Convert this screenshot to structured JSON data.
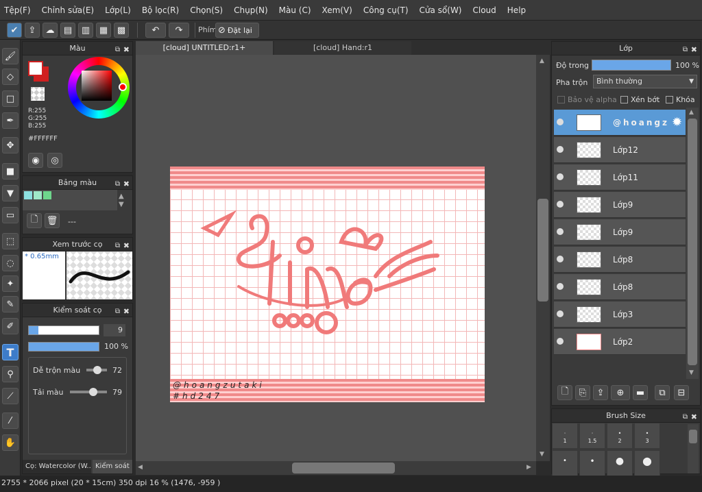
{
  "menu": [
    "Tệp(F)",
    "Chỉnh sửa(E)",
    "Lớp(L)",
    "Bộ lọc(R)",
    "Chọn(S)",
    "Chụp(N)",
    "Màu (C)",
    "Xem(V)",
    "Công cụ(T)",
    "Cửa sổ(W)",
    "Cloud",
    "Help"
  ],
  "toolbar": {
    "shortcut_label": "Phím",
    "reset_label": "Đặt lại"
  },
  "tools": [
    "brush-icon",
    "eraser-icon",
    "rectangle-select-tool-icon",
    "pen-icon",
    "move-icon",
    "fill-rect-icon",
    "bucket-icon",
    "gradient-icon",
    "marquee-icon",
    "lasso-icon",
    "magic-wand-icon",
    "select-pen-icon",
    "select-eraser-icon",
    "text-icon",
    "fill-select-icon",
    "smudge-icon",
    "eyedropper-icon",
    "hand-icon"
  ],
  "color_panel": {
    "title": "Màu",
    "r": "R:255",
    "g": "G:255",
    "b": "B:255",
    "hex": "#FFFFFF",
    "primary": "#ffffff",
    "secondary": "#d02020"
  },
  "swatch_panel": {
    "title": "Bảng màu",
    "swatches": [
      "#8de0e0",
      "#9fe8c8",
      "#6ed68c"
    ],
    "dash": "---"
  },
  "brush_preview": {
    "title": "Xem trước cọ",
    "size": "* 0.65mm"
  },
  "brush_control": {
    "title": "Kiểm soát cọ",
    "size_value": "9",
    "opacity_value": "100 %",
    "blend_label": "Dễ trộn màu",
    "blend_value": "72",
    "load_label": "Tải màu",
    "load_value": "79",
    "tab1": "Cọ: Watercolor (W...",
    "tab2": "Kiểm soát ..."
  },
  "tabs": [
    "[cloud] UNTITLED:r1+",
    "[cloud] Hand:r1"
  ],
  "canvas": {
    "word": "Time",
    "signature": "@hoangzutaki",
    "hashtag": "#hd247"
  },
  "layer_panel": {
    "title": "Lớp",
    "opacity_label": "Độ trong",
    "opacity_value": "100 %",
    "opacity_fraction": 1.0,
    "blend_label": "Pha trộn",
    "blend_mode": "Bình thường",
    "protect_alpha": "Bảo vệ alpha",
    "clip": "Xén bớt",
    "lock": "Khóa"
  },
  "layers": [
    {
      "name": "@hoangz",
      "selected": true
    },
    {
      "name": "Lớp12",
      "selected": false
    },
    {
      "name": "Lớp11",
      "selected": false
    },
    {
      "name": "Lớp9",
      "selected": false
    },
    {
      "name": "Lớp9",
      "selected": false
    },
    {
      "name": "Lớp8",
      "selected": false
    },
    {
      "name": "Lớp8",
      "selected": false
    },
    {
      "name": "Lớp3",
      "selected": false
    },
    {
      "name": "Lớp2",
      "selected": false
    }
  ],
  "brush_size_panel": {
    "title": "Brush Size",
    "sizes": [
      "1",
      "1.5",
      "2",
      "3"
    ]
  },
  "status": {
    "text": "2755 * 2066 pixel  (20 * 15cm)  350 dpi  16 %  (1476, -959 )"
  }
}
